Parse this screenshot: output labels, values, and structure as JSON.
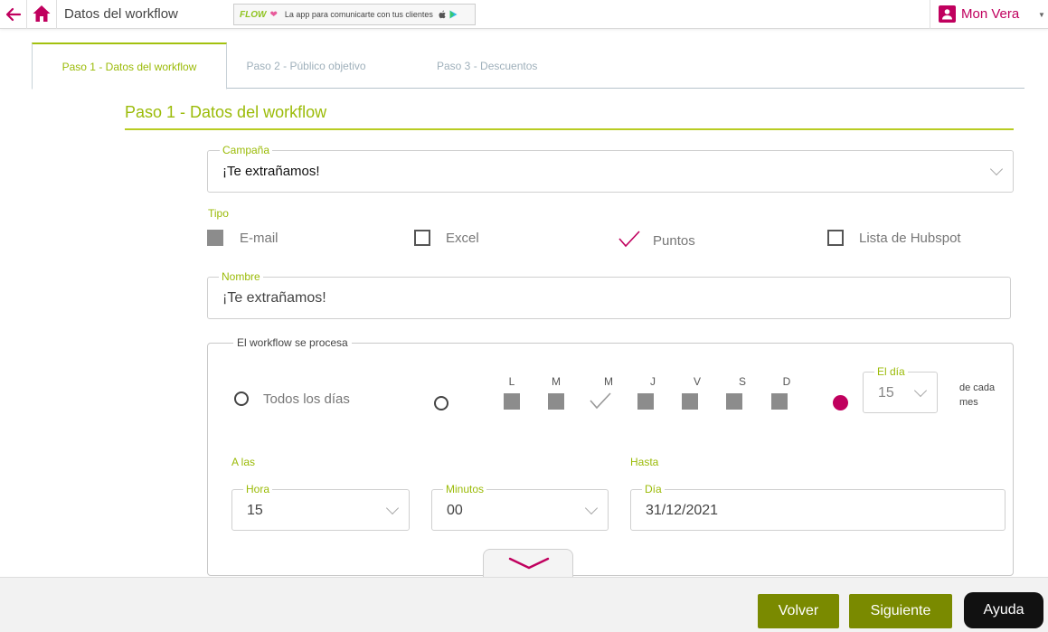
{
  "header": {
    "title": "Datos del workflow",
    "banner": {
      "logo": "FLOW",
      "text": "La app para comunicarte con tus clientes"
    },
    "user_name": "Mon Vera"
  },
  "tabs": [
    {
      "label": "Paso 1 - Datos del workflow",
      "active": true
    },
    {
      "label": "Paso 2 - Público objetivo",
      "active": false
    },
    {
      "label": "Paso 3 - Descuentos",
      "active": false
    }
  ],
  "section_title": "Paso 1 - Datos del workflow",
  "campaign": {
    "label": "Campaña",
    "value": "¡Te extrañamos!"
  },
  "type": {
    "label": "Tipo",
    "options": [
      {
        "label": "E-mail",
        "state": "disabled"
      },
      {
        "label": "Excel",
        "state": "unchecked"
      },
      {
        "label": "Puntos",
        "state": "checked"
      },
      {
        "label": "Lista de Hubspot",
        "state": "unchecked"
      }
    ]
  },
  "name": {
    "label": "Nombre",
    "value": "¡Te extrañamos!"
  },
  "process": {
    "legend": "El workflow se procesa",
    "every_day_label": "Todos los días",
    "weekdays": [
      {
        "label": "L",
        "state": "disabled"
      },
      {
        "label": "M",
        "state": "disabled"
      },
      {
        "label": "M",
        "state": "checked"
      },
      {
        "label": "J",
        "state": "disabled"
      },
      {
        "label": "V",
        "state": "disabled"
      },
      {
        "label": "S",
        "state": "disabled"
      },
      {
        "label": "D",
        "state": "disabled"
      }
    ],
    "day_field": {
      "label": "El día",
      "value": "15"
    },
    "each_month_line1": "de cada",
    "each_month_line2": "mes",
    "at_label": "A las",
    "hour": {
      "label": "Hora",
      "value": "15"
    },
    "minutes": {
      "label": "Minutos",
      "value": "00"
    },
    "until_label": "Hasta",
    "until_day": {
      "label": "Día",
      "value": "31/12/2021"
    }
  },
  "footer": {
    "back": "Volver",
    "next": "Siguiente",
    "help": "Ayuda"
  },
  "colors": {
    "accent_green": "#9bbb08",
    "brand_magenta": "#c0005e",
    "button_olive": "#7a8a00"
  }
}
